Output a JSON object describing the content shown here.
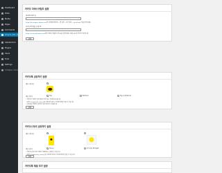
{
  "sidebar": {
    "items": [
      {
        "label": "Dashboard"
      },
      {
        "label": "Posts"
      },
      {
        "label": "Media"
      },
      {
        "label": "Pages"
      },
      {
        "label": "Comments"
      },
      {
        "label": "카카오톡 플러그인 설정"
      },
      {
        "label": "Appearance"
      },
      {
        "label": "Plugins"
      },
      {
        "label": "Users"
      },
      {
        "label": "Tools"
      },
      {
        "label": "Settings"
      },
      {
        "label": "Collapse menu"
      }
    ]
  },
  "sections": {
    "developer": {
      "title": "카카오 자바스크립트 설정",
      "field1_label": "JavaScript 키",
      "field1_help_link": "https://developers.kakao.com/",
      "field1_help": "의 내 애플리케이션 > 앱 설정 > 요약 정보 > JavaScript 키를 입력하세요.",
      "field2_label": "카카오톡 채널 공개 ID",
      "field2_help_link": "https://center-pf.kakao.com/",
      "field2_help": "에서 생성한 채널의 공개 ID를 입력하세요. 채널 URL의 마지막 부분입니다.",
      "save": "저장"
    },
    "talk_share": {
      "title": "카카오톡 공유하기 설정",
      "row1_label": "버튼 이미지",
      "row2_label": "버튼 위치",
      "opt1": "Top",
      "opt2": "Bottom",
      "opt3": "Top & Bottom",
      "note1": "* 공유하기 버튼은 글과 페이지 하단 또는 상단에 표시됩니다.",
      "note2": "* 숏코드 [kakaotalk_share] 를 사용하면 원하는 위치에 버튼을 넣을 수 있습니다.",
      "note3": "* 이미지를 선택하지 않으면 기본 이미지가 사용됩니다.",
      "save": "저장"
    },
    "story_share": {
      "title": "카카오스토리 공유하기 설정",
      "row1_label": "버튼 이미지",
      "row2_label": "버튼 위치",
      "opt1": "Show",
      "opt2": "On the Widget",
      "note1": "* 카카오스토리 공유 버튼은 위젯에서도 사용할 수 있습니다.",
      "note2": "* 숏코드 [kakaostory_share] 를 사용하면 원하는 위치에 버튼을 넣을 수 있습니다.",
      "save": "저장"
    },
    "channel": {
      "title": "카카오톡 채널 추가 설정"
    }
  },
  "colors": {
    "accent": "#0073aa",
    "kakao_yellow": "#fee500",
    "sidebar": "#23282d"
  }
}
